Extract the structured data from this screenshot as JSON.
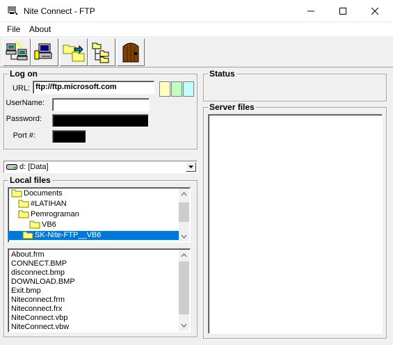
{
  "window": {
    "title": "Nite Connect - FTP"
  },
  "menu": {
    "items": [
      "File",
      "About"
    ]
  },
  "toolbar": {
    "buttons": [
      "connect-icon",
      "disconnect-icon",
      "download-icon",
      "directory-tree-icon",
      "exit-door-icon"
    ]
  },
  "logon": {
    "heading": "Log on",
    "url_label": "URL:",
    "url_value": "ftp://ftp.microsoft.com",
    "username_label": "UserName:",
    "username_value": "",
    "password_label": "Password:",
    "port_label": "Port #:",
    "swatch_colors": [
      "#ffffc0",
      "#c0ffc0",
      "#c0ffff"
    ]
  },
  "drive": {
    "selected": "d: [Data]"
  },
  "local": {
    "heading": "Local files",
    "folders": [
      "Documents",
      "#LATIHAN",
      "Pemrograman",
      "VB6",
      "SK-Nite-FTP__VB6"
    ],
    "selected_folder": "SK-Nite-FTP__VB6",
    "files": [
      "About.frm",
      "CONNECT.BMP",
      "disconnect.bmp",
      "DOWNLOAD.BMP",
      "Exit.bmp",
      "Niteconnect.frm",
      "Niteconnect.frx",
      "NiteConnect.vbp",
      "NiteConnect.vbw"
    ]
  },
  "status": {
    "heading": "Status"
  },
  "server": {
    "heading": "Server files"
  },
  "colors": {
    "selection": "#0078d7",
    "face": "#f0f0f0"
  }
}
